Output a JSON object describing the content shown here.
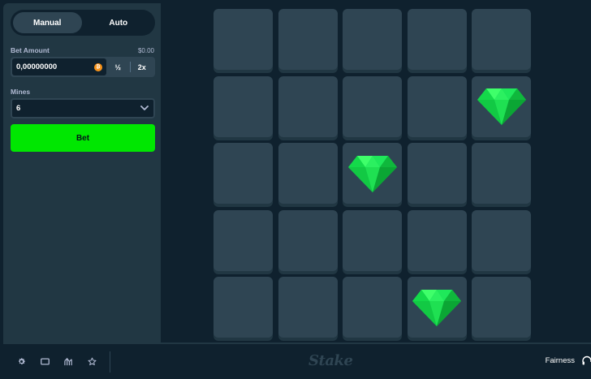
{
  "sidebar": {
    "tabs": [
      {
        "label": "Manual",
        "active": true
      },
      {
        "label": "Auto",
        "active": false
      }
    ],
    "bet_amount": {
      "label": "Bet Amount",
      "usd_value": "$0.00",
      "value": "0,00000000",
      "currency_icon": "bitcoin-icon",
      "half_label": "½",
      "double_label": "2x"
    },
    "mines": {
      "label": "Mines",
      "value": "6"
    },
    "bet_button_label": "Bet"
  },
  "board": {
    "rows": 5,
    "cols": 5,
    "tiles": [
      [
        "hidden",
        "hidden",
        "hidden",
        "hidden",
        "hidden"
      ],
      [
        "hidden",
        "hidden",
        "hidden",
        "hidden",
        "gem"
      ],
      [
        "hidden",
        "hidden",
        "gem",
        "hidden",
        "hidden"
      ],
      [
        "hidden",
        "hidden",
        "hidden",
        "hidden",
        "hidden"
      ],
      [
        "hidden",
        "hidden",
        "hidden",
        "gem",
        "hidden"
      ]
    ]
  },
  "footer": {
    "icons": [
      "gear-icon",
      "window-icon",
      "stats-icon",
      "star-icon"
    ],
    "logo": "Stake",
    "fairness_label": "Fairness",
    "support_icon": "headset-icon"
  },
  "colors": {
    "accent_green": "#00e701",
    "panel": "#213743",
    "tile": "#2f4553",
    "background": "#0f212e"
  }
}
